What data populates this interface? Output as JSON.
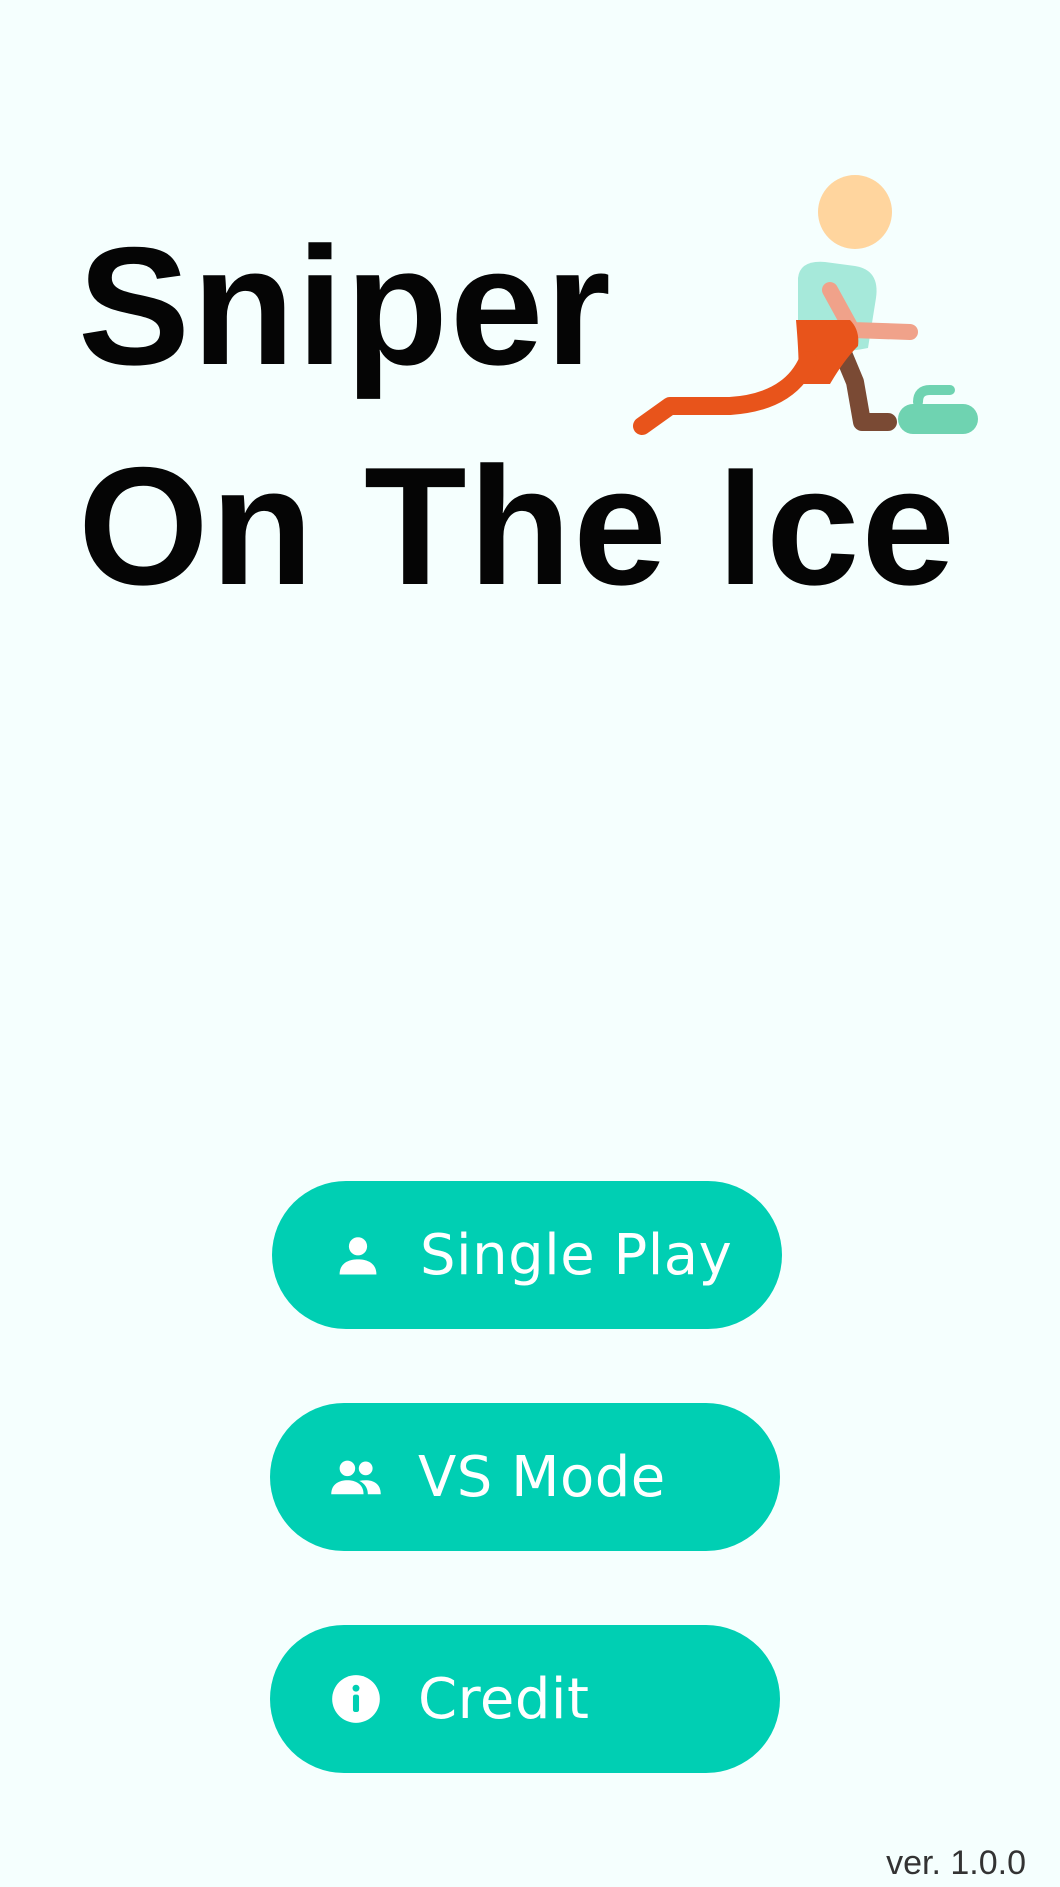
{
  "title": {
    "line1": "Sniper",
    "line2": "On The Ice"
  },
  "mascot": {
    "icon": "curling-player-icon",
    "colors": {
      "head": "#ffd59e",
      "shirt": "#a6e9da",
      "shorts": "#e8541b",
      "arm": "#f0a28a",
      "back_leg": "#7a4a34",
      "stone": "#6fd3b1"
    }
  },
  "menu": {
    "buttons": [
      {
        "id": "single",
        "label": "Single Play",
        "icon": "person-icon"
      },
      {
        "id": "vs",
        "label": "VS Mode",
        "icon": "people-icon"
      },
      {
        "id": "credit",
        "label": "Credit",
        "icon": "info-icon"
      }
    ]
  },
  "footer": {
    "version": "ver. 1.0.0"
  },
  "colors": {
    "background": "#f5fffe",
    "button": "#00cfb3",
    "button_text": "#ffffff",
    "title_text": "#050505"
  }
}
